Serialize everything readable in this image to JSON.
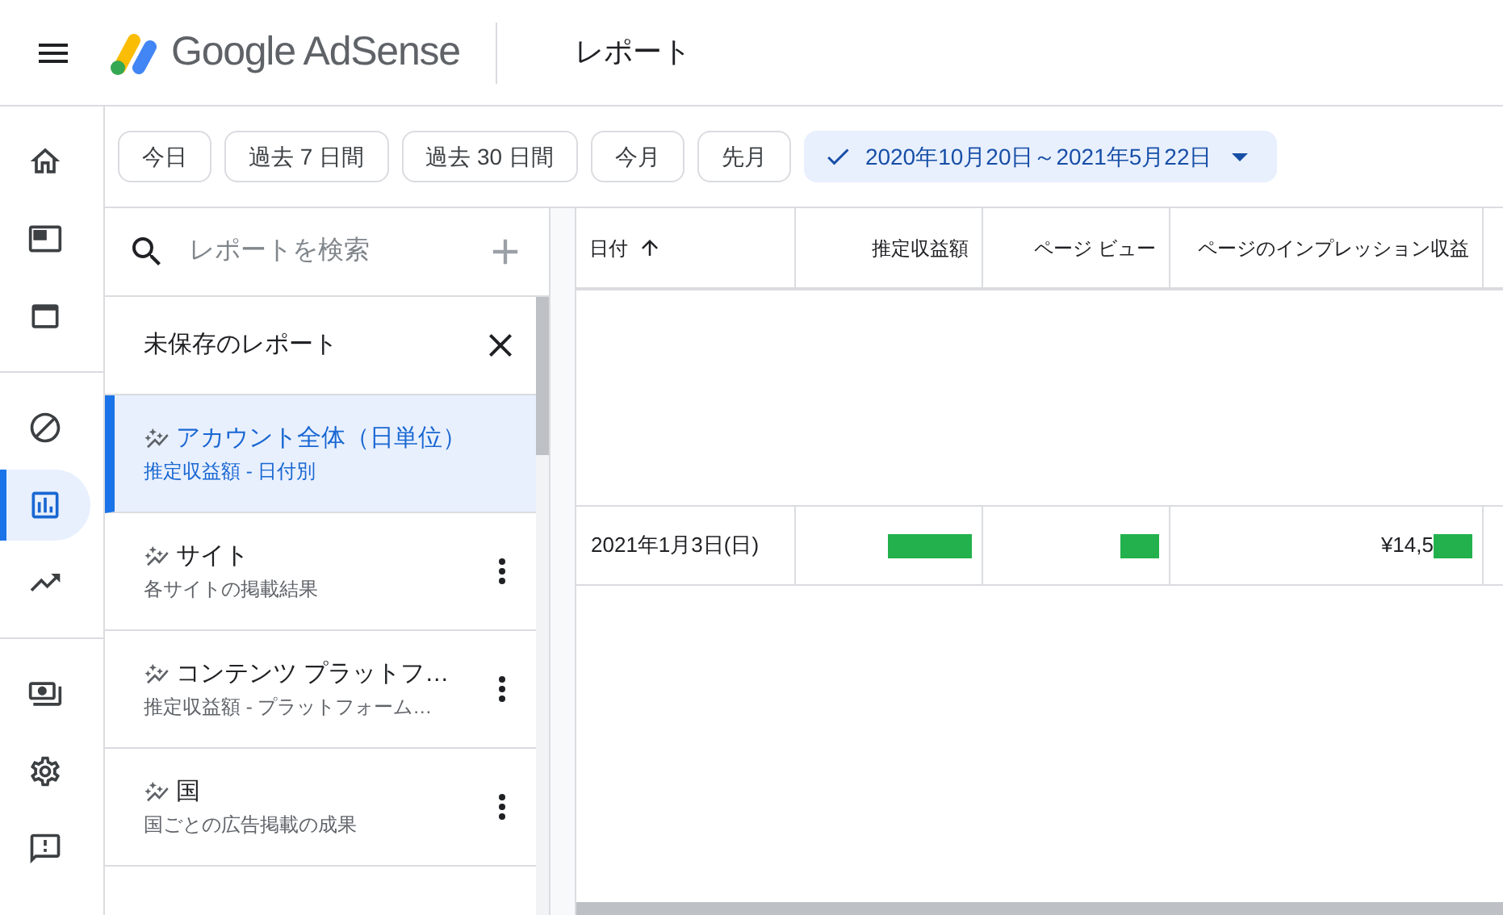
{
  "header": {
    "logo_text": "Google AdSense",
    "page_title": "レポート"
  },
  "nav": [
    [
      {
        "selected": false
      },
      {
        "selected": false
      },
      {
        "selected": false
      }
    ],
    [
      {
        "selected": false
      },
      {
        "selected": true
      },
      {
        "selected": false
      }
    ],
    [
      {
        "selected": false
      },
      {
        "selected": false
      },
      {
        "selected": false
      }
    ]
  ],
  "date_filters": [
    {
      "label": "今日",
      "selected": false
    },
    {
      "label": "過去 7 日間",
      "selected": false
    },
    {
      "label": "過去 30 日間",
      "selected": false
    },
    {
      "label": "今月",
      "selected": false
    },
    {
      "label": "先月",
      "selected": false
    },
    {
      "label": "2020年10月20日～2021年5月22日",
      "selected": true
    }
  ],
  "report_panel": {
    "search": {
      "placeholder": "レポートを検索"
    },
    "unsaved_report": "未保存のレポート",
    "reports": [
      {
        "title": "アカウント全体（日単位）",
        "subtitle": "推定収益額 - 日付別",
        "selected": true
      },
      {
        "title": "サイト",
        "subtitle": "各サイトの掲載結果",
        "selected": false
      },
      {
        "title": "コンテンツ プラットフ…",
        "subtitle": "推定収益額 - プラットフォーム…",
        "selected": false
      },
      {
        "title": "国",
        "subtitle": "国ごとの広告掲載の成果",
        "selected": false
      }
    ]
  },
  "table": {
    "columns": [
      {
        "label": "日付",
        "sorted": true
      },
      {
        "label": "推定収益額",
        "sorted": false
      },
      {
        "label": "ページ ビュー",
        "sorted": false
      },
      {
        "label": "ページのインプレッション収益",
        "sorted": false
      }
    ],
    "rows": [
      {
        "cells": [
          {
            "text": "2021年1月3日(日)",
            "redacted": false
          },
          {
            "redacted": true,
            "kind": "wide"
          },
          {
            "redacted": true,
            "kind": "narrow"
          },
          {
            "text": "¥14,5",
            "redacted": true,
            "kind": "narrow"
          }
        ]
      }
    ]
  }
}
